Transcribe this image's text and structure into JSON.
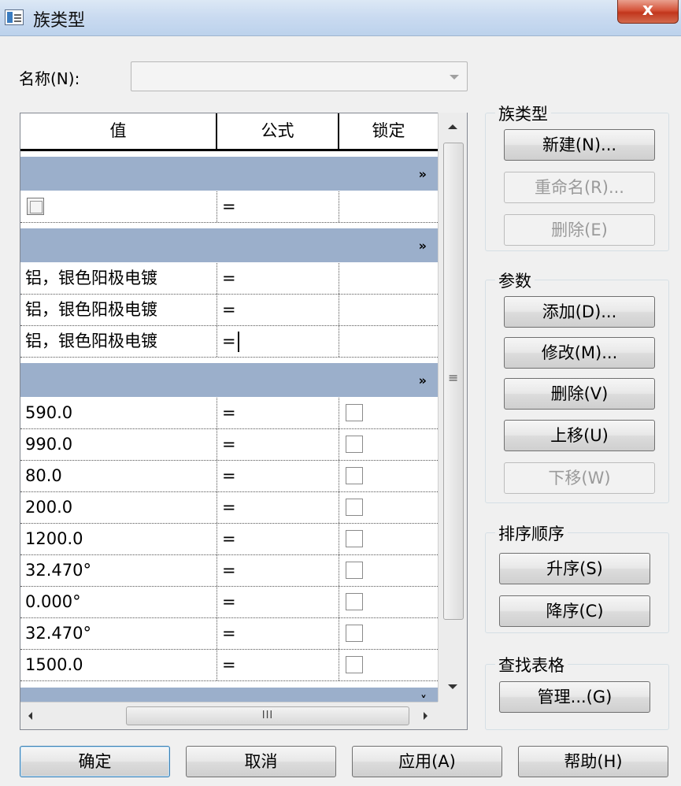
{
  "window": {
    "title": "族类型",
    "close_label": "x"
  },
  "name_row": {
    "label": "名称(N):",
    "value": ""
  },
  "grid": {
    "headers": [
      "值",
      "公式",
      "锁定"
    ],
    "group_chevron": "»",
    "rows": [
      {
        "value": "",
        "formula": "="
      },
      {
        "value": "铝，银色阳极电镀",
        "formula": "="
      },
      {
        "value": "铝，银色阳极电镀",
        "formula": "="
      },
      {
        "value": "铝，银色阳极电镀",
        "formula": "="
      },
      {
        "value": "590.0",
        "formula": "="
      },
      {
        "value": "990.0",
        "formula": "="
      },
      {
        "value": "80.0",
        "formula": "="
      },
      {
        "value": "200.0",
        "formula": "="
      },
      {
        "value": "1200.0",
        "formula": "="
      },
      {
        "value": "32.470°",
        "formula": "="
      },
      {
        "value": "0.000°",
        "formula": "="
      },
      {
        "value": "32.470°",
        "formula": "="
      },
      {
        "value": "1500.0",
        "formula": "="
      }
    ],
    "hscroll_grip": "III"
  },
  "family_types": {
    "title": "族类型",
    "new_label": "新建(N)...",
    "rename_label": "重命名(R)...",
    "delete_label": "删除(E)"
  },
  "parameters": {
    "title": "参数",
    "add_label": "添加(D)...",
    "modify_label": "修改(M)...",
    "delete_label": "删除(V)",
    "move_up_label": "上移(U)",
    "move_down_label": "下移(W)"
  },
  "sort_order": {
    "title": "排序顺序",
    "ascending_label": "升序(S)",
    "descending_label": "降序(C)"
  },
  "lookup_tables": {
    "title": "查找表格",
    "manage_label": "管理...(G)"
  },
  "footer": {
    "ok_label": "确定",
    "cancel_label": "取消",
    "apply_label": "应用(A)",
    "help_label": "帮助(H)"
  }
}
